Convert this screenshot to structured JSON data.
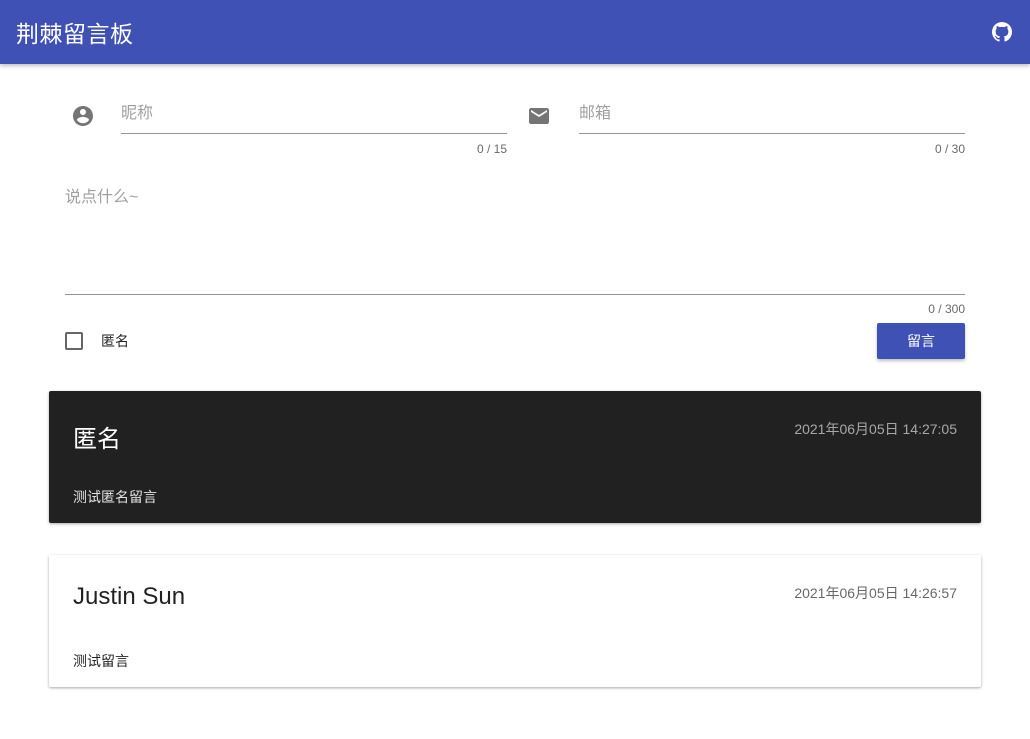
{
  "appbar": {
    "title": "荆棘留言板",
    "github_icon": "github-icon",
    "color": "#3f51b5"
  },
  "form": {
    "nickname": {
      "icon": "account-circle-icon",
      "value": "",
      "placeholder": "昵称",
      "counter": "0 / 15"
    },
    "email": {
      "icon": "email-icon",
      "value": "",
      "placeholder": "邮箱",
      "counter": "0 / 30"
    },
    "message": {
      "value": "",
      "placeholder": "说点什么~",
      "counter": "0 / 300"
    },
    "anonymous": {
      "label": "匿名",
      "checked": false
    },
    "submit_label": "留言"
  },
  "messages": [
    {
      "name": "匿名",
      "time": "2021年06月05日 14:27:05",
      "text": "测试匿名留言",
      "theme": "dark"
    },
    {
      "name": "Justin Sun",
      "time": "2021年06月05日 14:26:57",
      "text": "测试留言",
      "theme": "light"
    }
  ]
}
